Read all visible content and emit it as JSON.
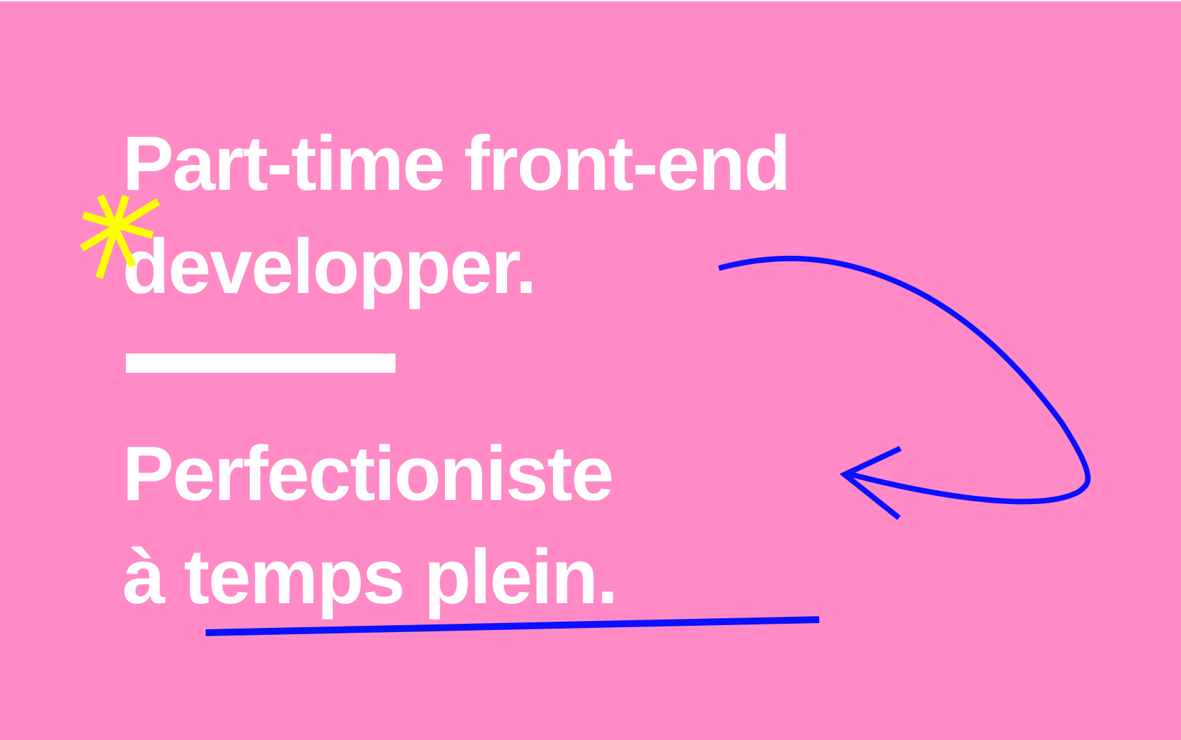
{
  "headline": {
    "line1": "Part-time front-end",
    "line2": "developper.",
    "line3": "Perfectioniste",
    "line4_prefix": "à ",
    "line4_underlined": "temps plein."
  },
  "colors": {
    "background": "#ff8ac5",
    "text": "#ffffff",
    "accent_blue": "#0a10ff",
    "accent_yellow": "#ffff00"
  },
  "decorations": {
    "asterisk_icon": "asterisk-icon",
    "arrow_icon": "curved-arrow-icon",
    "underline": "hand-drawn-underline"
  }
}
